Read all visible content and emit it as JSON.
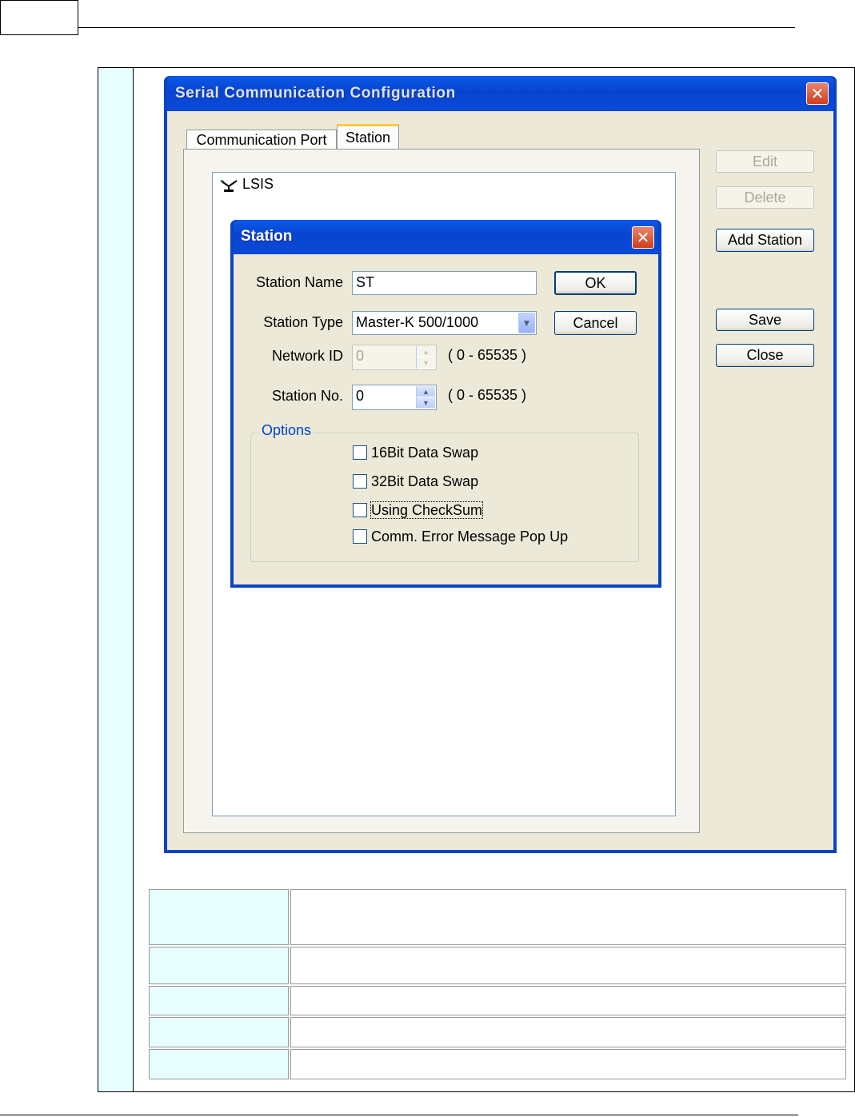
{
  "main_dialog": {
    "title": "Serial Communication Configuration",
    "close_glyph": "✕"
  },
  "tabs": [
    {
      "label": "Communication Port"
    },
    {
      "label": "Station",
      "selected": true
    }
  ],
  "tree": {
    "root_label": "LSIS",
    "root_icon": "antenna-icon"
  },
  "side_buttons": {
    "edit": {
      "label": "Edit",
      "enabled": false
    },
    "delete": {
      "label": "Delete",
      "enabled": false
    },
    "add_station": {
      "label": "Add Station",
      "enabled": true
    },
    "save": {
      "label": "Save",
      "enabled": true
    },
    "close": {
      "label": "Close",
      "enabled": true
    }
  },
  "station_dialog": {
    "title": "Station",
    "close_glyph": "✕",
    "fields": {
      "station_name": {
        "label": "Station Name",
        "value": "ST"
      },
      "station_type": {
        "label": "Station Type",
        "value": "Master-K 500/1000"
      },
      "network_id": {
        "label": "Network ID",
        "value": "0",
        "range": "( 0 - 65535 )",
        "enabled": false
      },
      "station_no": {
        "label": "Station No.",
        "value": "0",
        "range": "( 0 - 65535 )",
        "enabled": true
      }
    },
    "buttons": {
      "ok": "OK",
      "cancel": "Cancel"
    },
    "options": {
      "legend": "Options",
      "items": [
        {
          "label": "16Bit Data Swap",
          "checked": false
        },
        {
          "label": "32Bit Data Swap",
          "checked": false
        },
        {
          "label": "Using CheckSum",
          "checked": false,
          "focused": true
        },
        {
          "label": "Comm. Error Message Pop Up",
          "checked": false
        }
      ]
    }
  },
  "colors": {
    "title_blue": "#0a44c6",
    "dialog_face": "#ece9d8",
    "cyan_cell": "#e8ffff",
    "close_red": "#cf3d1c"
  }
}
